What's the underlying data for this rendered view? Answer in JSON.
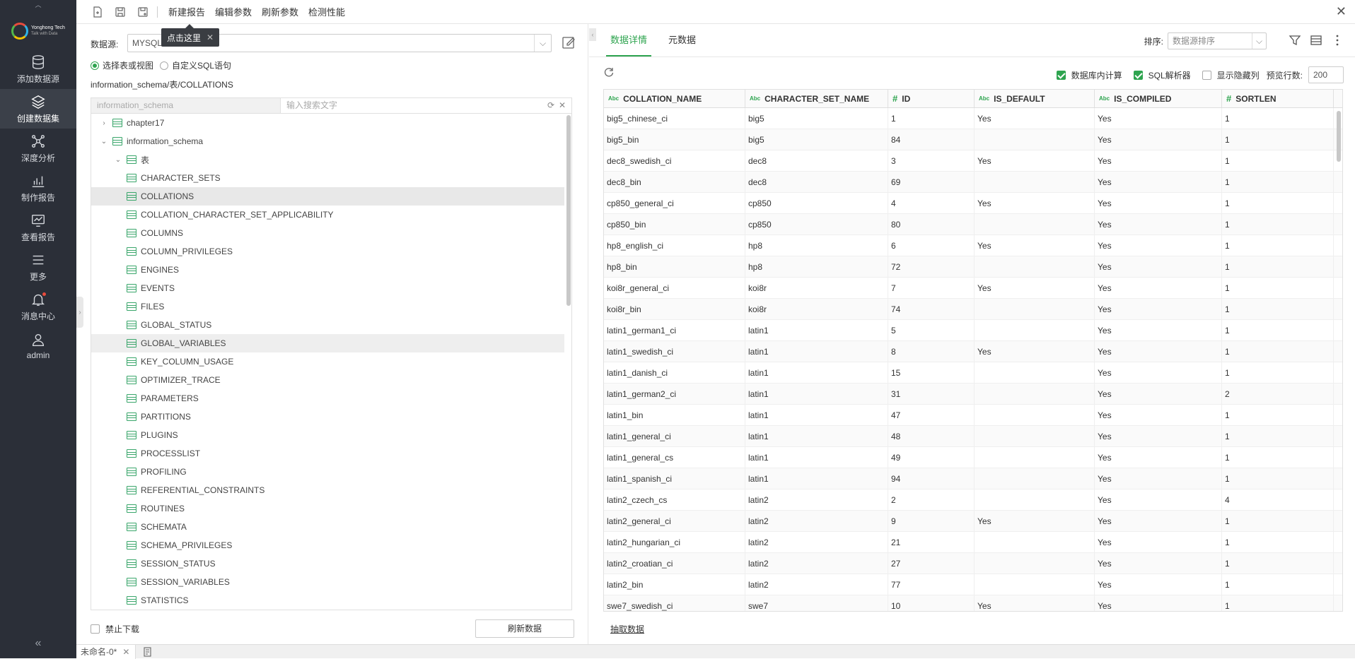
{
  "sidebar": {
    "logo_text": "Yonghong Tech",
    "logo_sub": "Talk with Data",
    "items": [
      {
        "label": "添加数据源",
        "icon": "database-icon"
      },
      {
        "label": "创建数据集",
        "icon": "layers-icon",
        "active": true
      },
      {
        "label": "深度分析",
        "icon": "network-icon"
      },
      {
        "label": "制作报告",
        "icon": "bar-chart-icon"
      },
      {
        "label": "查看报告",
        "icon": "line-chart-icon"
      },
      {
        "label": "更多",
        "icon": "menu-icon"
      },
      {
        "label": "消息中心",
        "icon": "bell-icon"
      },
      {
        "label": "admin",
        "icon": "user-icon"
      }
    ],
    "collapse_label": "«"
  },
  "toolbar": {
    "menus": [
      "新建报告",
      "编辑参数",
      "刷新参数",
      "检测性能"
    ],
    "tooltip": "点击这里"
  },
  "left_panel": {
    "datasource_label": "数据源:",
    "datasource_value": "MYSQL",
    "radio_table": "选择表或视图",
    "radio_sql": "自定义SQL语句",
    "path": "information_schema/表/COLLATIONS",
    "db_placeholder": "information_schema",
    "search_placeholder": "输入搜索文字",
    "tree": [
      {
        "label": "chapter17",
        "level": 0,
        "caret": "›",
        "type": "db"
      },
      {
        "label": "information_schema",
        "level": 0,
        "caret": "⌄",
        "type": "db"
      },
      {
        "label": "表",
        "level": 1,
        "caret": "⌄",
        "type": "folder"
      },
      {
        "label": "CHARACTER_SETS",
        "level": 2,
        "type": "table"
      },
      {
        "label": "COLLATIONS",
        "level": 2,
        "type": "table",
        "state": "selected"
      },
      {
        "label": "COLLATION_CHARACTER_SET_APPLICABILITY",
        "level": 2,
        "type": "table"
      },
      {
        "label": "COLUMNS",
        "level": 2,
        "type": "table"
      },
      {
        "label": "COLUMN_PRIVILEGES",
        "level": 2,
        "type": "table"
      },
      {
        "label": "ENGINES",
        "level": 2,
        "type": "table"
      },
      {
        "label": "EVENTS",
        "level": 2,
        "type": "table"
      },
      {
        "label": "FILES",
        "level": 2,
        "type": "table"
      },
      {
        "label": "GLOBAL_STATUS",
        "level": 2,
        "type": "table"
      },
      {
        "label": "GLOBAL_VARIABLES",
        "level": 2,
        "type": "table",
        "state": "hover"
      },
      {
        "label": "KEY_COLUMN_USAGE",
        "level": 2,
        "type": "table"
      },
      {
        "label": "OPTIMIZER_TRACE",
        "level": 2,
        "type": "table"
      },
      {
        "label": "PARAMETERS",
        "level": 2,
        "type": "table"
      },
      {
        "label": "PARTITIONS",
        "level": 2,
        "type": "table"
      },
      {
        "label": "PLUGINS",
        "level": 2,
        "type": "table"
      },
      {
        "label": "PROCESSLIST",
        "level": 2,
        "type": "table"
      },
      {
        "label": "PROFILING",
        "level": 2,
        "type": "table"
      },
      {
        "label": "REFERENTIAL_CONSTRAINTS",
        "level": 2,
        "type": "table"
      },
      {
        "label": "ROUTINES",
        "level": 2,
        "type": "table"
      },
      {
        "label": "SCHEMATA",
        "level": 2,
        "type": "table"
      },
      {
        "label": "SCHEMA_PRIVILEGES",
        "level": 2,
        "type": "table"
      },
      {
        "label": "SESSION_STATUS",
        "level": 2,
        "type": "table"
      },
      {
        "label": "SESSION_VARIABLES",
        "level": 2,
        "type": "table"
      },
      {
        "label": "STATISTICS",
        "level": 2,
        "type": "table"
      }
    ],
    "no_download": "禁止下载",
    "refresh_button": "刷新数据"
  },
  "right_panel": {
    "tabs": [
      "数据详情",
      "元数据"
    ],
    "sort_label": "排序:",
    "sort_placeholder": "数据源排序",
    "options": {
      "db_compute": "数据库内计算",
      "sql_parser": "SQL解析器",
      "show_hidden": "显示隐藏列",
      "preview_rows_label": "预览行数:",
      "preview_rows": "200"
    },
    "columns": [
      {
        "name": "COLLATION_NAME",
        "type": "Abc"
      },
      {
        "name": "CHARACTER_SET_NAME",
        "type": "Abc"
      },
      {
        "name": "ID",
        "type": "#"
      },
      {
        "name": "IS_DEFAULT",
        "type": "Abc"
      },
      {
        "name": "IS_COMPILED",
        "type": "Abc"
      },
      {
        "name": "SORTLEN",
        "type": "#"
      }
    ],
    "rows": [
      [
        "big5_chinese_ci",
        "big5",
        "1",
        "Yes",
        "Yes",
        "1"
      ],
      [
        "big5_bin",
        "big5",
        "84",
        "",
        "Yes",
        "1"
      ],
      [
        "dec8_swedish_ci",
        "dec8",
        "3",
        "Yes",
        "Yes",
        "1"
      ],
      [
        "dec8_bin",
        "dec8",
        "69",
        "",
        "Yes",
        "1"
      ],
      [
        "cp850_general_ci",
        "cp850",
        "4",
        "Yes",
        "Yes",
        "1"
      ],
      [
        "cp850_bin",
        "cp850",
        "80",
        "",
        "Yes",
        "1"
      ],
      [
        "hp8_english_ci",
        "hp8",
        "6",
        "Yes",
        "Yes",
        "1"
      ],
      [
        "hp8_bin",
        "hp8",
        "72",
        "",
        "Yes",
        "1"
      ],
      [
        "koi8r_general_ci",
        "koi8r",
        "7",
        "Yes",
        "Yes",
        "1"
      ],
      [
        "koi8r_bin",
        "koi8r",
        "74",
        "",
        "Yes",
        "1"
      ],
      [
        "latin1_german1_ci",
        "latin1",
        "5",
        "",
        "Yes",
        "1"
      ],
      [
        "latin1_swedish_ci",
        "latin1",
        "8",
        "Yes",
        "Yes",
        "1"
      ],
      [
        "latin1_danish_ci",
        "latin1",
        "15",
        "",
        "Yes",
        "1"
      ],
      [
        "latin1_german2_ci",
        "latin1",
        "31",
        "",
        "Yes",
        "2"
      ],
      [
        "latin1_bin",
        "latin1",
        "47",
        "",
        "Yes",
        "1"
      ],
      [
        "latin1_general_ci",
        "latin1",
        "48",
        "",
        "Yes",
        "1"
      ],
      [
        "latin1_general_cs",
        "latin1",
        "49",
        "",
        "Yes",
        "1"
      ],
      [
        "latin1_spanish_ci",
        "latin1",
        "94",
        "",
        "Yes",
        "1"
      ],
      [
        "latin2_czech_cs",
        "latin2",
        "2",
        "",
        "Yes",
        "4"
      ],
      [
        "latin2_general_ci",
        "latin2",
        "9",
        "Yes",
        "Yes",
        "1"
      ],
      [
        "latin2_hungarian_ci",
        "latin2",
        "21",
        "",
        "Yes",
        "1"
      ],
      [
        "latin2_croatian_ci",
        "latin2",
        "27",
        "",
        "Yes",
        "1"
      ],
      [
        "latin2_bin",
        "latin2",
        "77",
        "",
        "Yes",
        "1"
      ],
      [
        "swe7_swedish_ci",
        "swe7",
        "10",
        "Yes",
        "Yes",
        "1"
      ]
    ],
    "extract_link": "抽取数据"
  },
  "status_bar": {
    "doc_tab": "未命名-0*"
  },
  "colors": {
    "accent": "#2ea44f",
    "sidebar_bg": "#2b2f38"
  }
}
